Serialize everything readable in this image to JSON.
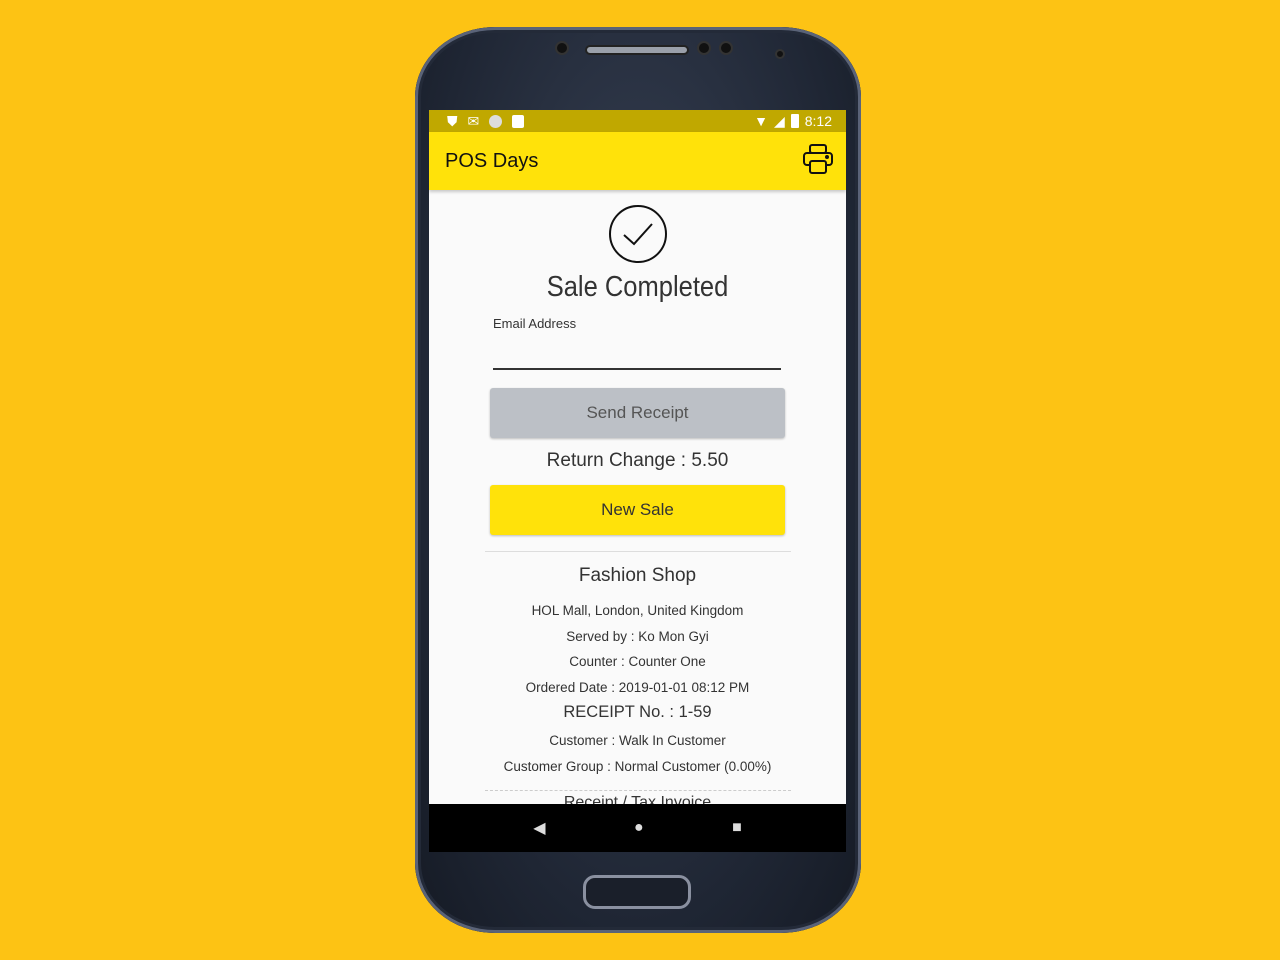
{
  "status_bar": {
    "time": "8:12",
    "icons": [
      "shield-icon",
      "gmail-icon",
      "circle-icon",
      "sd-card-icon",
      "wifi-icon",
      "signal-icon",
      "battery-icon"
    ]
  },
  "app_bar": {
    "title": "POS Days",
    "print_icon": "printer-icon"
  },
  "main": {
    "heading": "Sale Completed",
    "email_label": "Email Address",
    "email_value": "",
    "send_receipt": "Send Receipt",
    "return_change": "Return Change : 5.50",
    "new_sale": "New Sale"
  },
  "receipt": {
    "shop": "Fashion Shop",
    "address": "HOL Mall, London, United Kingdom",
    "served_by": "Served by : Ko Mon Gyi",
    "counter": "Counter : Counter One",
    "ordered_date": "Ordered Date : 2019-01-01 08:12 PM",
    "receipt_no": "RECEIPT No. : 1-59",
    "customer": "Customer : Walk In Customer",
    "customer_group": "Customer Group : Normal Customer (0.00%)",
    "title": "Receipt / Tax Invoice"
  },
  "colors": {
    "accent": "#ffe20a",
    "background": "#fdc314",
    "status_bar": "#c0a800"
  }
}
